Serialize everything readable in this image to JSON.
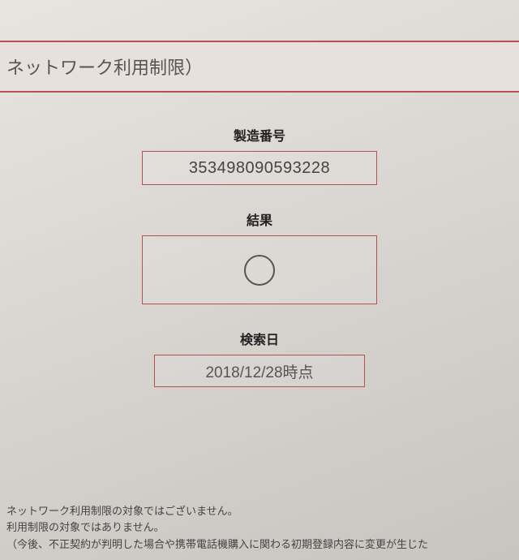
{
  "header": {
    "title": "ネットワーク利用制限）"
  },
  "sections": {
    "serial": {
      "label": "製造番号",
      "value": "353498090593228"
    },
    "result": {
      "label": "結果"
    },
    "date": {
      "label": "検索日",
      "value": "2018/12/28時点"
    }
  },
  "footer": {
    "line1": "ネットワーク利用制限の対象ではございません。",
    "line2": "利用制限の対象ではありません。",
    "line3": "（今後、不正契約が判明した場合や携帯電話機購入に関わる初期登録内容に変更が生じた"
  }
}
